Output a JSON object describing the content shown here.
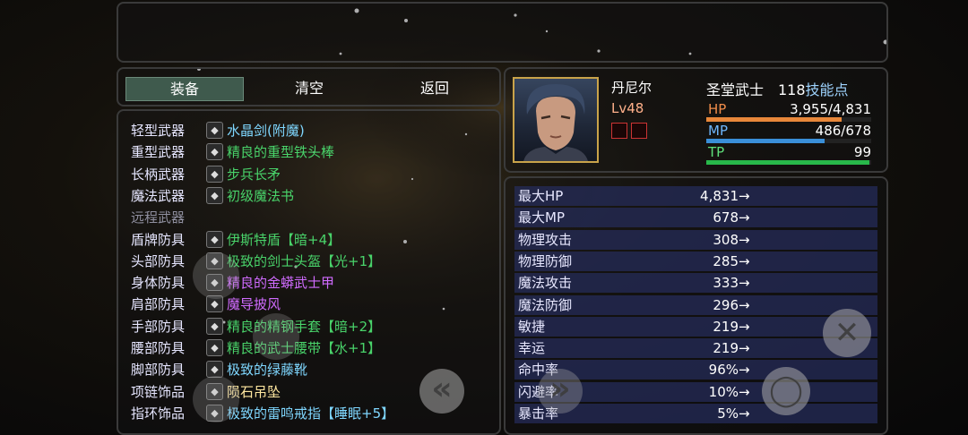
{
  "tabs": {
    "equip": "装备",
    "clear": "清空",
    "back": "返回"
  },
  "equipment": [
    {
      "slot": "轻型武器",
      "item": "水晶剑(附魔)",
      "color": "#7fd7ff",
      "icon": "sword-icon"
    },
    {
      "slot": "重型武器",
      "item": "精良的重型铁头棒",
      "color": "#49d36a",
      "icon": "club-icon"
    },
    {
      "slot": "长柄武器",
      "item": "步兵长矛",
      "color": "#49d36a",
      "icon": "spear-icon"
    },
    {
      "slot": "魔法武器",
      "item": "初级魔法书",
      "color": "#49d36a",
      "icon": "spellbook-icon"
    },
    {
      "slot": "远程武器",
      "item": "",
      "color": "#8f8f9f",
      "icon": ""
    },
    {
      "slot": "盾牌防具",
      "item": "伊斯特盾【暗+4】",
      "color": "#49d36a",
      "icon": "shield-icon"
    },
    {
      "slot": "头部防具",
      "item": "极致的剑士头盔【光+1】",
      "color": "#49d36a",
      "icon": "helmet-icon"
    },
    {
      "slot": "身体防具",
      "item": "精良的金蟒武士甲",
      "color": "#d06bff",
      "icon": "armor-icon"
    },
    {
      "slot": "肩部防具",
      "item": "魔导披风",
      "color": "#d06bff",
      "icon": "cloak-icon"
    },
    {
      "slot": "手部防具",
      "item": "精良的精钢手套【暗+2】",
      "color": "#49d36a",
      "icon": "gauntlet-icon"
    },
    {
      "slot": "腰部防具",
      "item": "精良的武士腰带【水+1】",
      "color": "#49d36a",
      "icon": "belt-icon"
    },
    {
      "slot": "脚部防具",
      "item": "极致的绿藤靴",
      "color": "#7fd7ff",
      "icon": "boots-icon"
    },
    {
      "slot": "项链饰品",
      "item": "陨石吊坠",
      "color": "#ffe7a0",
      "icon": "pendant-icon"
    },
    {
      "slot": "指环饰品",
      "item": "极致的雷鸣戒指【睡眠+5】",
      "color": "#7fd7ff",
      "icon": "ring-icon"
    }
  ],
  "character": {
    "name": "丹尼尔",
    "level": "Lv48",
    "class": "圣堂武士",
    "skill_points": "118",
    "skill_points_label": "技能点",
    "hp": {
      "label": "HP",
      "value": "3,955/4,831",
      "ratio": 0.819,
      "color": "#e8873a",
      "label_color": "#f08c4a"
    },
    "mp": {
      "label": "MP",
      "value": "486/678",
      "ratio": 0.717,
      "color": "#3a8fd8",
      "label_color": "#6fb8ff"
    },
    "tp": {
      "label": "TP",
      "value": "99",
      "ratio": 0.99,
      "color": "#28b84a",
      "label_color": "#5fe07a"
    }
  },
  "stats": [
    {
      "name": "最大HP",
      "value": "4,831"
    },
    {
      "name": "最大MP",
      "value": "678"
    },
    {
      "name": "物理攻击",
      "value": "308"
    },
    {
      "name": "物理防御",
      "value": "285"
    },
    {
      "name": "魔法攻击",
      "value": "333"
    },
    {
      "name": "魔法防御",
      "value": "296"
    },
    {
      "name": "敏捷",
      "value": "219"
    },
    {
      "name": "幸运",
      "value": "219"
    },
    {
      "name": "命中率",
      "value": "96%"
    },
    {
      "name": "闪避率",
      "value": "10%"
    },
    {
      "name": "暴击率",
      "value": "5%"
    }
  ],
  "stat_arrow": "→"
}
